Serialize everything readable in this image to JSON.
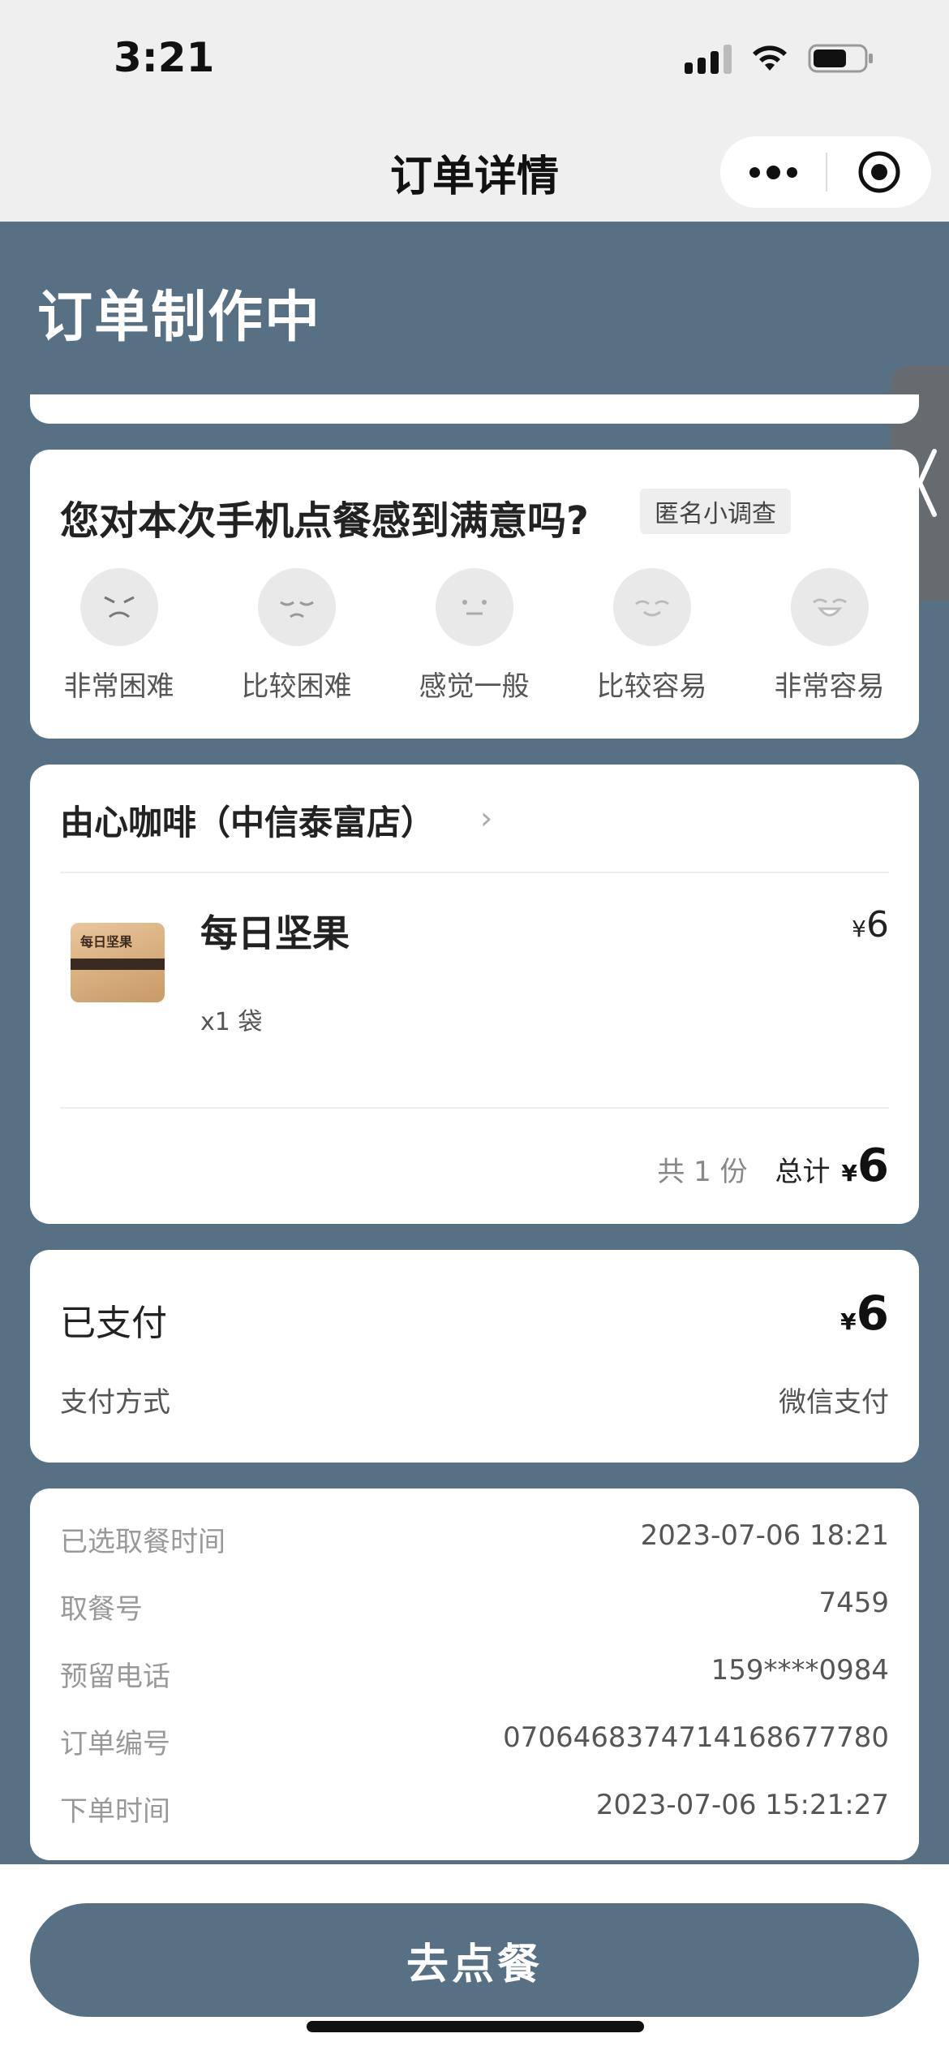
{
  "status_bar": {
    "time": "3:21"
  },
  "navbar": {
    "title": "订单详情"
  },
  "header": {
    "status": "订单制作中"
  },
  "survey": {
    "question": "您对本次手机点餐感到满意吗?",
    "tag": "匿名小调查",
    "options": [
      "非常困难",
      "比较困难",
      "感觉一般",
      "比较容易",
      "非常容易"
    ]
  },
  "store": {
    "name": "由心咖啡（中信泰富店）",
    "item": {
      "name": "每日坚果",
      "qty": "x1 袋",
      "price_symbol": "¥",
      "price": "6",
      "image_text": "每日坚果"
    },
    "count_text": "共 1 份",
    "total_label": "总计",
    "total_symbol": "¥",
    "total_value": "6"
  },
  "payment": {
    "status": "已支付",
    "amount_symbol": "¥",
    "amount": "6",
    "method_label": "支付方式",
    "method_value": "微信支付"
  },
  "details": {
    "rows": [
      {
        "label": "已选取餐时间",
        "value": "2023-07-06 18:21"
      },
      {
        "label": "取餐号",
        "value": "7459"
      },
      {
        "label": "预留电话",
        "value": "159****0984"
      },
      {
        "label": "订单编号",
        "value": "0706468374714168677780"
      },
      {
        "label": "下单时间",
        "value": "2023-07-06 15:21:27"
      }
    ]
  },
  "action": {
    "order_button": "去点餐"
  },
  "colors": {
    "theme": "#587084",
    "card": "#ffffff",
    "nav_bg": "#efefef"
  },
  "icons": [
    "signal-icon",
    "wifi-icon",
    "battery-icon",
    "more-icon",
    "close-miniprogram-icon",
    "collapse-tab-icon",
    "chevron-right-icon"
  ]
}
